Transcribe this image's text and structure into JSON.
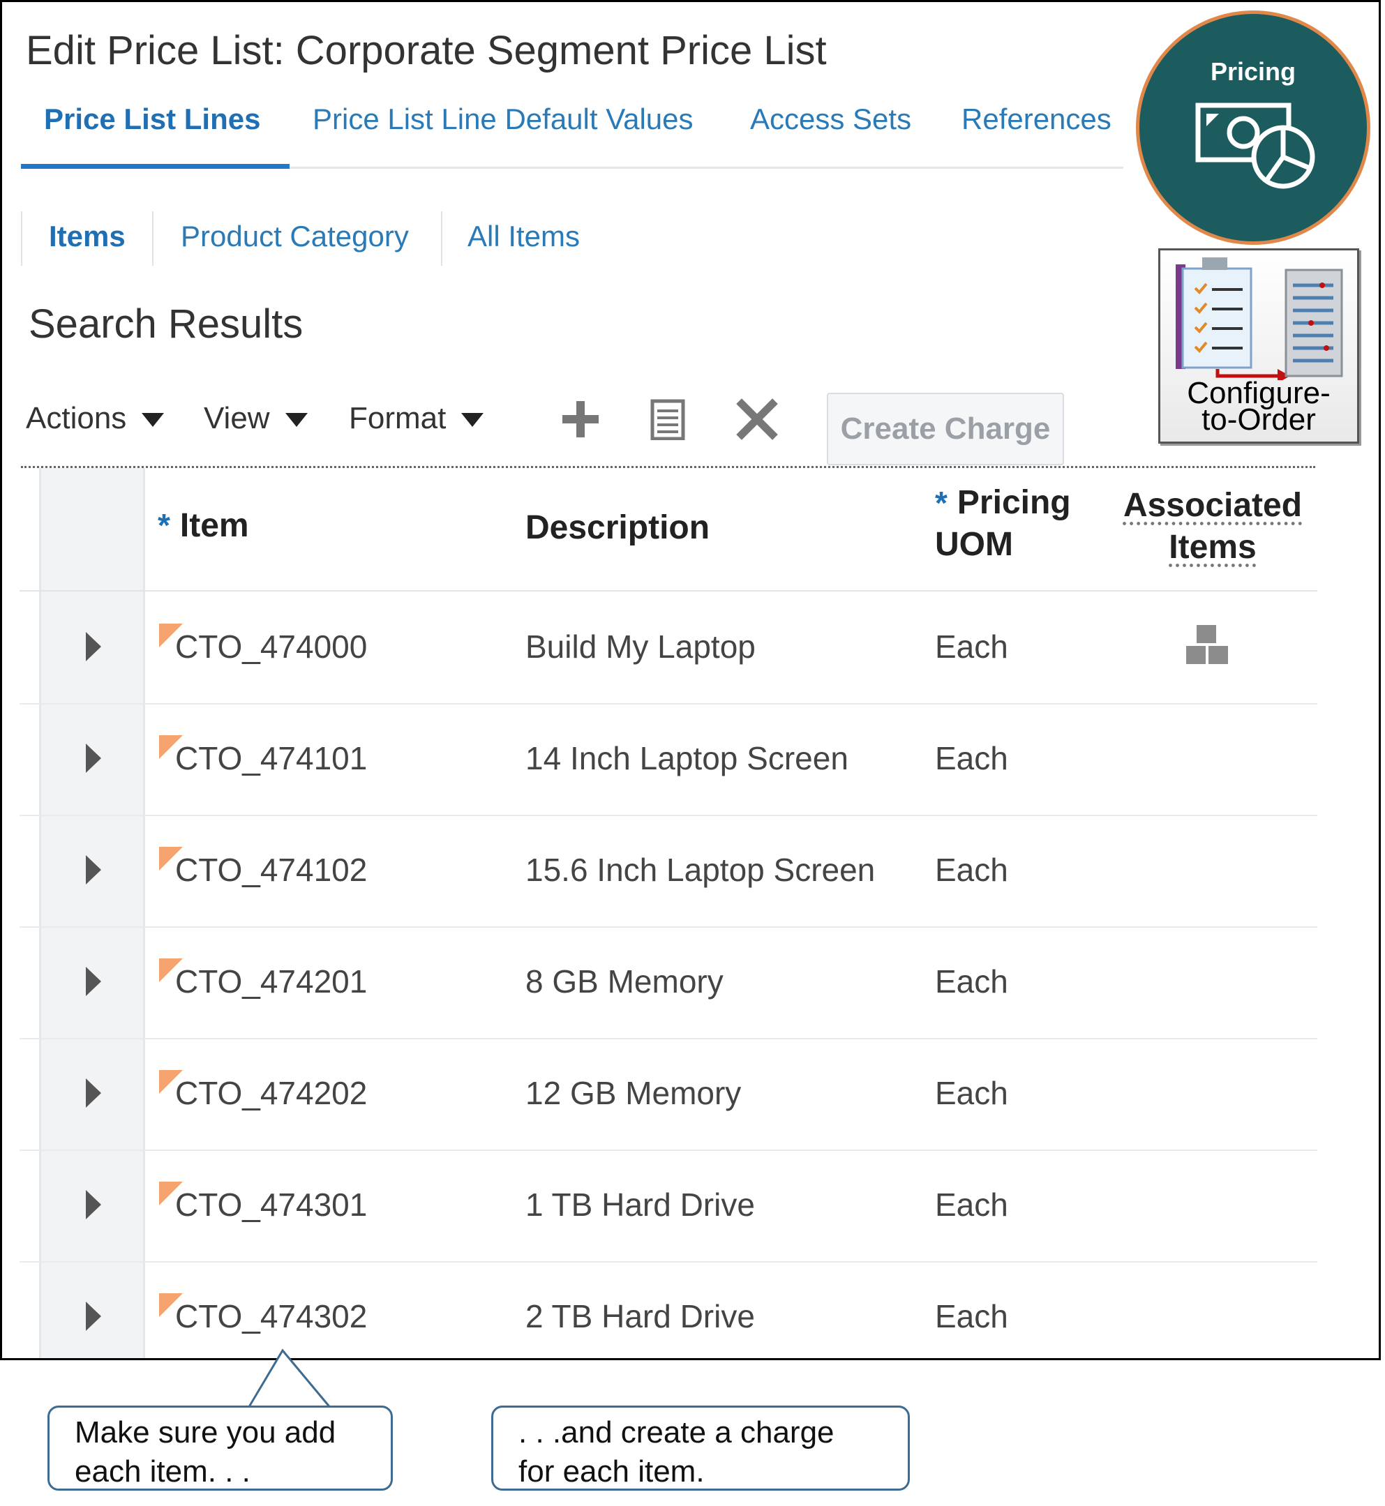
{
  "page": {
    "title": "Edit Price List: Corporate Segment Price List"
  },
  "tabs": [
    {
      "label": "Price List Lines",
      "active": true
    },
    {
      "label": "Price List Line Default Values",
      "active": false
    },
    {
      "label": "Access Sets",
      "active": false
    },
    {
      "label": "References",
      "active": false
    }
  ],
  "subtabs": [
    {
      "label": "Items",
      "active": true
    },
    {
      "label": "Product Category",
      "active": false
    },
    {
      "label": "All Items",
      "active": false
    }
  ],
  "section": {
    "title": "Search Results"
  },
  "toolbar": {
    "actions_label": "Actions",
    "view_label": "View",
    "format_label": "Format",
    "add_icon": "plus-icon",
    "edit_icon": "document-icon",
    "delete_icon": "x-icon",
    "create_charge_label": "Create Charge"
  },
  "table": {
    "headers": {
      "item": "Item",
      "description": "Description",
      "pricing_uom_line1": "Pricing",
      "pricing_uom_line2": "UOM",
      "associated_line1": "Associated",
      "associated_line2": "Items",
      "required_marker": "*"
    },
    "rows": [
      {
        "item": "CTO_474000",
        "description": "Build My Laptop",
        "uom": "Each",
        "has_associated_items": true
      },
      {
        "item": "CTO_474101",
        "description": "14 Inch Laptop Screen",
        "uom": "Each",
        "has_associated_items": false
      },
      {
        "item": "CTO_474102",
        "description": "15.6 Inch Laptop Screen",
        "uom": "Each",
        "has_associated_items": false
      },
      {
        "item": "CTO_474201",
        "description": "8 GB Memory",
        "uom": "Each",
        "has_associated_items": false
      },
      {
        "item": "CTO_474202",
        "description": "12 GB Memory",
        "uom": "Each",
        "has_associated_items": false
      },
      {
        "item": "CTO_474301",
        "description": "1 TB Hard Drive",
        "uom": "Each",
        "has_associated_items": false
      },
      {
        "item": "CTO_474302",
        "description": "2 TB Hard Drive",
        "uom": "Each",
        "has_associated_items": false
      }
    ]
  },
  "badges": {
    "pricing": {
      "label": "Pricing"
    },
    "cto": {
      "line1": "Configure-",
      "line2": "to-Order"
    }
  },
  "callouts": {
    "left": {
      "line1": "Make sure you add",
      "line2": "each item. . ."
    },
    "right": {
      "line1": ". . .and create a charge",
      "line2": "for each item."
    }
  },
  "colors": {
    "link": "#2a7ab8",
    "tab_underline": "#1f78c8",
    "pricing_badge": "#1c5b5e",
    "pricing_badge_ring": "#e0884a",
    "flag": "#f5a36f",
    "callout_border": "#3d6b92"
  }
}
